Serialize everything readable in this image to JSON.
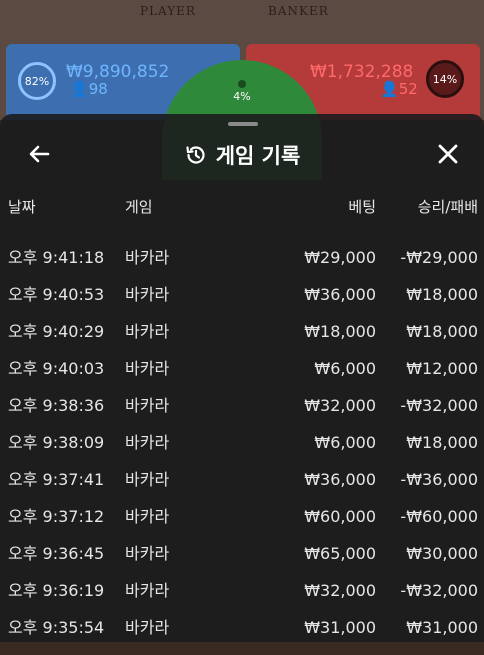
{
  "background": {
    "player_label": "PLAYER",
    "banker_label": "BANKER",
    "player_percent": "82%",
    "player_amount": "₩9,890,852",
    "player_count": "98",
    "banker_percent": "14%",
    "banker_amount": "₩1,732,288",
    "banker_count": "52",
    "tie_percent": "4%"
  },
  "header": {
    "title": "게임 기록"
  },
  "columns": {
    "date": "날짜",
    "game": "게임",
    "bet": "베팅",
    "result": "승리/패배"
  },
  "rows": [
    {
      "time": "오후 9:41:18",
      "game": "바카라",
      "bet": "₩29,000",
      "result": "-₩29,000"
    },
    {
      "time": "오후 9:40:53",
      "game": "바카라",
      "bet": "₩36,000",
      "result": "₩18,000"
    },
    {
      "time": "오후 9:40:29",
      "game": "바카라",
      "bet": "₩18,000",
      "result": "₩18,000"
    },
    {
      "time": "오후 9:40:03",
      "game": "바카라",
      "bet": "₩6,000",
      "result": "₩12,000"
    },
    {
      "time": "오후 9:38:36",
      "game": "바카라",
      "bet": "₩32,000",
      "result": "-₩32,000"
    },
    {
      "time": "오후 9:38:09",
      "game": "바카라",
      "bet": "₩6,000",
      "result": "₩18,000"
    },
    {
      "time": "오후 9:37:41",
      "game": "바카라",
      "bet": "₩36,000",
      "result": "-₩36,000"
    },
    {
      "time": "오후 9:37:12",
      "game": "바카라",
      "bet": "₩60,000",
      "result": "-₩60,000"
    },
    {
      "time": "오후 9:36:45",
      "game": "바카라",
      "bet": "₩65,000",
      "result": "₩30,000"
    },
    {
      "time": "오후 9:36:19",
      "game": "바카라",
      "bet": "₩32,000",
      "result": "-₩32,000"
    },
    {
      "time": "오후 9:35:54",
      "game": "바카라",
      "bet": "₩31,000",
      "result": "₩31,000"
    }
  ]
}
